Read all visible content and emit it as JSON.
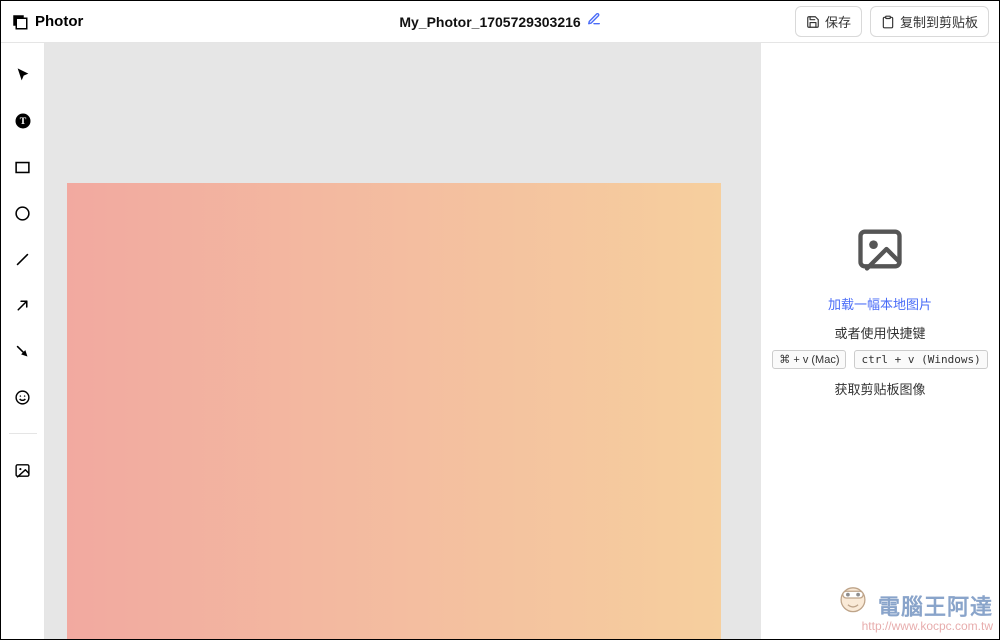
{
  "header": {
    "brand": "Photor",
    "title": "My_Photor_1705729303216",
    "save_label": "保存",
    "copy_label": "复制到剪贴板"
  },
  "tools": {
    "select": "select-tool",
    "text": "text-tool",
    "rect": "rectangle-tool",
    "circle": "circle-tool",
    "line": "line-tool",
    "arrow_up": "arrow-up-tool",
    "arrow_down": "arrow-down-tool",
    "emoji": "emoji-tool",
    "image": "image-tool"
  },
  "sidepanel": {
    "load_link": "加载一幅本地图片",
    "or_shortcut": "或者使用快捷键",
    "kbd_mac": "⌘ + v (Mac)",
    "kbd_win": "ctrl + v (Windows)",
    "clipboard_text": "获取剪贴板图像"
  },
  "watermark": {
    "title": "電腦王阿達",
    "url": "http://www.kocpc.com.tw"
  }
}
